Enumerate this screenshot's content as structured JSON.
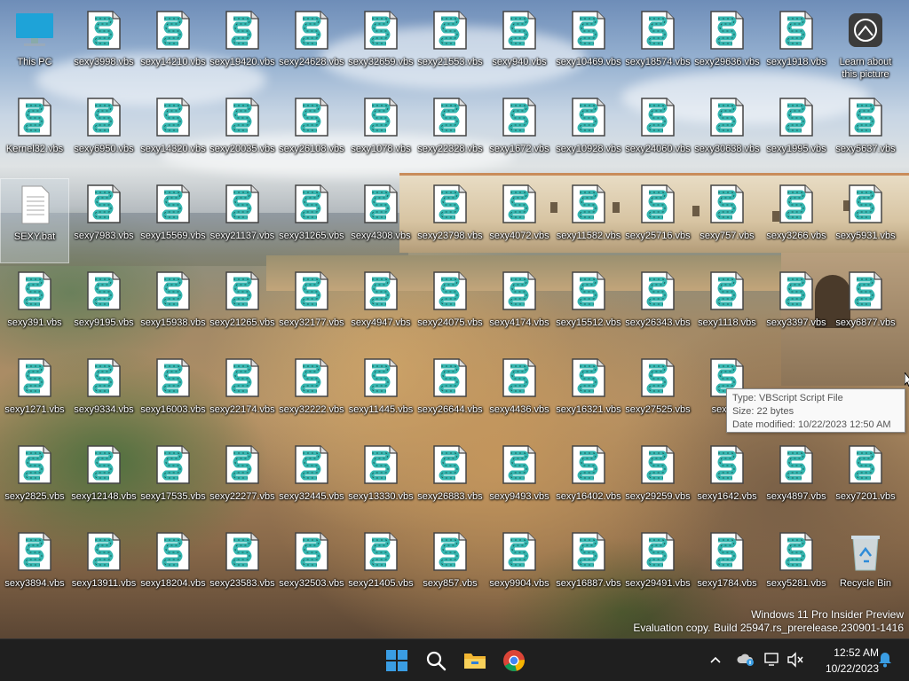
{
  "desktop": {
    "row1": [
      "This PC",
      "sexy3998.vbs",
      "sexy14210.vbs",
      "sexy19420.vbs",
      "sexy24628.vbs",
      "sexy32659.vbs",
      "sexy21553.vbs",
      "sexy940.vbs",
      "sexy10469.vbs",
      "sexy18574.vbs",
      "sexy29636.vbs",
      "sexy1918.vbs",
      "Learn about this picture"
    ],
    "row2": [
      "Kernel32.vbs",
      "sexy6950.vbs",
      "sexy14320.vbs",
      "sexy20035.vbs",
      "sexy26108.vbs",
      "sexy1078.vbs",
      "sexy22328.vbs",
      "sexy1672.vbs",
      "sexy10928.vbs",
      "sexy24060.vbs",
      "sexy30638.vbs",
      "sexy1995.vbs",
      "sexy5637.vbs"
    ],
    "row3": [
      "SEXY.bat",
      "sexy7983.vbs",
      "sexy15569.vbs",
      "sexy21137.vbs",
      "sexy31265.vbs",
      "sexy4308.vbs",
      "sexy23798.vbs",
      "sexy4072.vbs",
      "sexy11582.vbs",
      "sexy25716.vbs",
      "sexy757.vbs",
      "sexy3266.vbs",
      "sexy5931.vbs"
    ],
    "row4": [
      "sexy391.vbs",
      "sexy9195.vbs",
      "sexy15938.vbs",
      "sexy21265.vbs",
      "sexy32177.vbs",
      "sexy4947.vbs",
      "sexy24075.vbs",
      "sexy4174.vbs",
      "sexy15512.vbs",
      "sexy26343.vbs",
      "sexy1118.vbs",
      "sexy3397.vbs",
      "sexy6877.vbs"
    ],
    "row5": [
      "sexy1271.vbs",
      "sexy9334.vbs",
      "sexy16003.vbs",
      "sexy22174.vbs",
      "sexy32222.vbs",
      "sexy11445.vbs",
      "sexy26644.vbs",
      "sexy4436.vbs",
      "sexy16321.vbs",
      "sexy27525.vbs",
      "sexy14",
      "",
      ""
    ],
    "row6": [
      "sexy2825.vbs",
      "sexy12148.vbs",
      "sexy17535.vbs",
      "sexy22277.vbs",
      "sexy32445.vbs",
      "sexy13330.vbs",
      "sexy26883.vbs",
      "sexy9493.vbs",
      "sexy16402.vbs",
      "sexy29259.vbs",
      "sexy1642.vbs",
      "sexy4897.vbs",
      "sexy7201.vbs"
    ],
    "row7": [
      "sexy3894.vbs",
      "sexy13911.vbs",
      "sexy18204.vbs",
      "sexy23583.vbs",
      "sexy32503.vbs",
      "sexy21405.vbs",
      "sexy857.vbs",
      "sexy9904.vbs",
      "sexy16887.vbs",
      "sexy29491.vbs",
      "sexy1784.vbs",
      "sexy5281.vbs",
      "Recycle Bin"
    ]
  },
  "tooltip": {
    "type": "Type: VBScript Script File",
    "size": "Size: 22 bytes",
    "modified": "Date modified: 10/22/2023 12:50 AM"
  },
  "watermark": {
    "line1": "Windows 11 Pro Insider Preview",
    "line2": "Evaluation copy. Build 25947.rs_prerelease.230901-1416"
  },
  "taskbar": {
    "time": "12:52 AM",
    "date": "10/22/2023",
    "pinned": [
      "start-button",
      "search-button",
      "file-explorer-button",
      "chrome-button"
    ]
  },
  "colors": {
    "taskbar_bg": "#1f1f1f",
    "vbs_icon_teal": "#35b6b0",
    "this_pc_blue": "#1ea3d8",
    "start_blue": "#3a9de3"
  }
}
